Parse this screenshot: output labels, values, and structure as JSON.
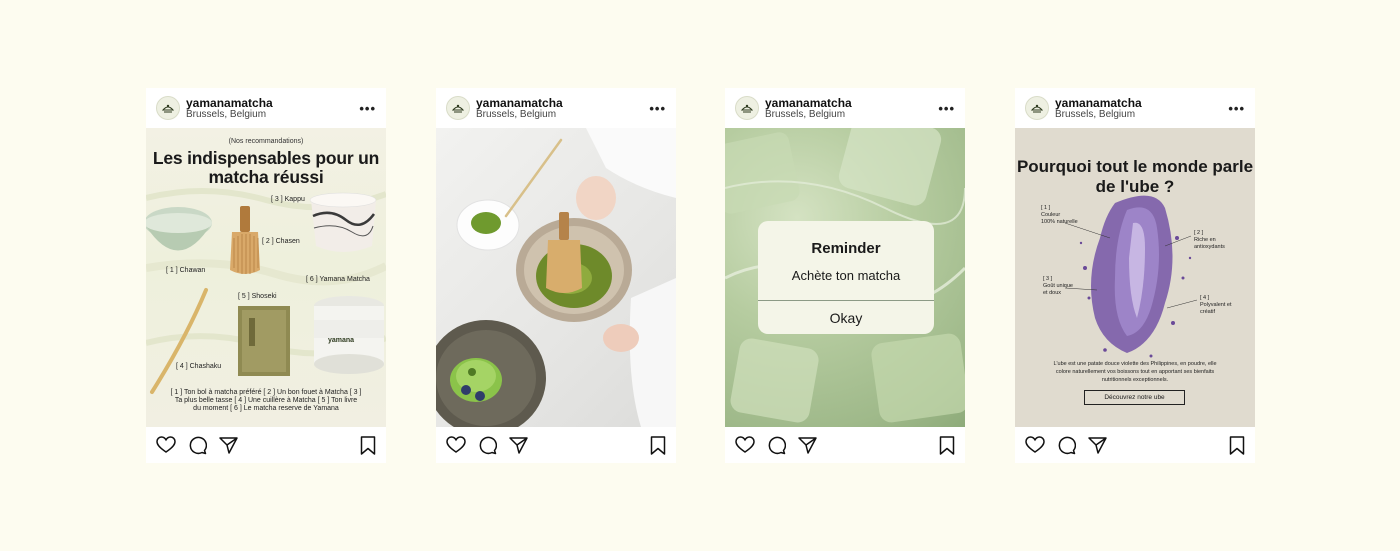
{
  "posts": [
    {
      "username": "yamanamatcha",
      "location": "Brussels, Belgium",
      "more": "•••",
      "subtitle": "(Nos recommandations)",
      "title": "Les indispensables pour un matcha réussi",
      "labels": [
        "[ 3 ]  Kappu",
        "[ 2 ]  Chasen",
        "[ 1 ]  Chawan",
        "[ 6 ]  Yamana Matcha",
        "[ 5 ]  Shoseki",
        "[ 4 ]  Chashaku"
      ],
      "product_label": "yamana",
      "footer": "[ 1 ] Ton bol à matcha préféré [ 2 ] Un bon fouet à Matcha [ 3 ] Ta plus belle tasse [ 4 ] Une cuillère à Matcha [ 5 ] Ton livre du moment [ 6 ] Le matcha reserve de Yamana"
    },
    {
      "username": "yamanamatcha",
      "location": "Brussels, Belgium",
      "more": "•••"
    },
    {
      "username": "yamanamatcha",
      "location": "Brussels, Belgium",
      "more": "•••",
      "dialog": {
        "title": "Reminder",
        "message": "Achète ton matcha",
        "button": "Okay"
      }
    },
    {
      "username": "yamanamatcha",
      "location": "Brussels, Belgium",
      "more": "•••",
      "title": "Pourquoi tout le monde parle de l'ube ?",
      "labels": [
        "[ 1 ]\nCouleur\n100% naturelle",
        "[ 2 ]\nRiche en\nantioxydants",
        "[ 3 ]\nGoût unique\net doux",
        "[ 4 ]\nPolyvalent et\ncréatif"
      ],
      "description": "L'ube est une patate douce violette des Philippines, en poudre, elle colore naturellement vos boissons tout en apportant ses bienfaits nutritionnels exceptionnels.",
      "cta": "Découvrez notre ube"
    }
  ],
  "icons": [
    "logo-icon",
    "heart-icon",
    "comment-icon",
    "share-icon",
    "bookmark-icon"
  ],
  "colors": {
    "background": "#fdfcf0",
    "matcha_green": "#7ea34a",
    "ube_purple": "#8a6bb8",
    "dialog_bg": "#f4f5e8"
  }
}
